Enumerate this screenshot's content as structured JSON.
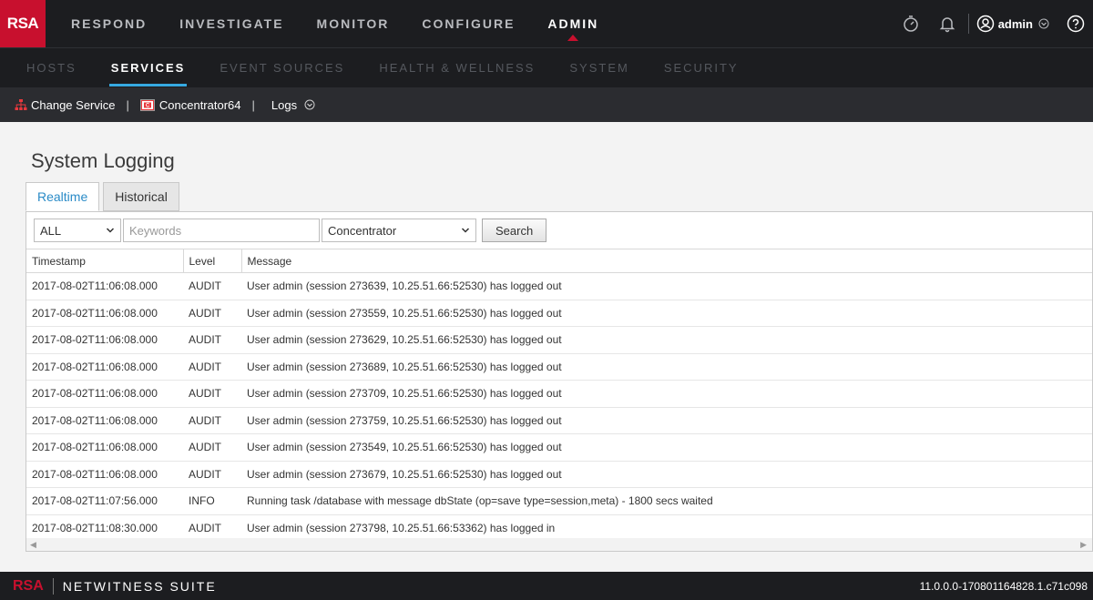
{
  "topnav": {
    "logo": "RSA",
    "items": [
      "RESPOND",
      "INVESTIGATE",
      "MONITOR",
      "CONFIGURE",
      "ADMIN"
    ],
    "active": "ADMIN",
    "user": "admin"
  },
  "subnav": {
    "items": [
      "HOSTS",
      "SERVICES",
      "EVENT SOURCES",
      "HEALTH & WELLNESS",
      "SYSTEM",
      "SECURITY"
    ],
    "active": "SERVICES"
  },
  "toolbar": {
    "change_service": "Change Service",
    "service_name": "Concentrator64",
    "logs": "Logs"
  },
  "page": {
    "title": "System Logging",
    "tabs": [
      "Realtime",
      "Historical"
    ],
    "active_tab": "Realtime"
  },
  "filters": {
    "level": "ALL",
    "keywords_placeholder": "Keywords",
    "service": "Concentrator",
    "search_label": "Search"
  },
  "table": {
    "columns": [
      "Timestamp",
      "Level",
      "Message"
    ],
    "rows": [
      [
        "2017-08-02T11:06:08.000",
        "AUDIT",
        "User admin (session 273639, 10.25.51.66:52530) has logged out"
      ],
      [
        "2017-08-02T11:06:08.000",
        "AUDIT",
        "User admin (session 273559, 10.25.51.66:52530) has logged out"
      ],
      [
        "2017-08-02T11:06:08.000",
        "AUDIT",
        "User admin (session 273629, 10.25.51.66:52530) has logged out"
      ],
      [
        "2017-08-02T11:06:08.000",
        "AUDIT",
        "User admin (session 273689, 10.25.51.66:52530) has logged out"
      ],
      [
        "2017-08-02T11:06:08.000",
        "AUDIT",
        "User admin (session 273709, 10.25.51.66:52530) has logged out"
      ],
      [
        "2017-08-02T11:06:08.000",
        "AUDIT",
        "User admin (session 273759, 10.25.51.66:52530) has logged out"
      ],
      [
        "2017-08-02T11:06:08.000",
        "AUDIT",
        "User admin (session 273549, 10.25.51.66:52530) has logged out"
      ],
      [
        "2017-08-02T11:06:08.000",
        "AUDIT",
        "User admin (session 273679, 10.25.51.66:52530) has logged out"
      ],
      [
        "2017-08-02T11:07:56.000",
        "INFO",
        "Running task /database with message dbState (op=save type=session,meta) - 1800 secs waited"
      ],
      [
        "2017-08-02T11:08:30.000",
        "AUDIT",
        "User admin (session 273798, 10.25.51.66:53362) has logged in"
      ]
    ]
  },
  "footer": {
    "logo": "RSA",
    "suite": "NETWITNESS SUITE",
    "version": "11.0.0.0-170801164828.1.c71c098"
  },
  "colors": {
    "brand_red": "#c8102e",
    "accent_blue": "#36a9e1",
    "nav_bg": "#1c1d20"
  }
}
